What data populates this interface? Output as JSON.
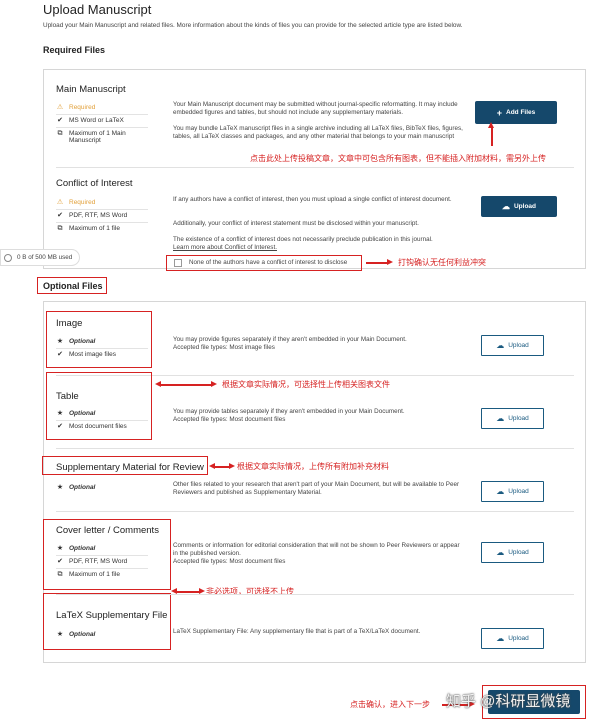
{
  "header": {
    "title": "Upload Manuscript",
    "description": "Upload your Main Manuscript and related files. More information about the kinds of files you can provide for the selected article type are listed below.",
    "required_title": "Required Files",
    "optional_title": "Optional Files"
  },
  "storage": {
    "label": "0 B of 500 MB used"
  },
  "main_manuscript": {
    "title": "Main Manuscript",
    "meta": [
      "Required",
      "MS Word or LaTeX",
      "Maximum of 1 Main Manuscript"
    ],
    "desc1": "Your Main Manuscript document may be submitted without journal-specific reformatting. It may include embedded figures and tables, but should not include any supplementary materials.",
    "desc2": "You may bundle LaTeX manuscript files in a single archive including all LaTeX files, BibTeX files, figures, tables, all LaTeX classes and packages, and any other material that belongs to your main manuscript",
    "button": "Add Files"
  },
  "conflict": {
    "title": "Conflict of Interest",
    "meta": [
      "Required",
      "PDF, RTF, MS Word",
      "Maximum of 1 file"
    ],
    "desc1": "If any authors have a conflict of interest, then you must upload a single conflict of interest document.",
    "desc2": "Additionally, your conflict of interest statement must be disclosed within your manuscript.",
    "desc3": "The existence of a conflict of interest does not necessarily preclude publication in this journal.",
    "link": "Learn more about Conflict of Interest.",
    "checkbox": "None of the authors have a conflict of interest to disclose",
    "button": "Upload"
  },
  "optional": [
    {
      "title": "Image",
      "meta": [
        "Optional",
        "Most image files"
      ],
      "desc": [
        "You may provide figures separately if they aren't embedded in your Main Document.",
        "Accepted file types: Most image files"
      ],
      "button": "Upload"
    },
    {
      "title": "Table",
      "meta": [
        "Optional",
        "Most document files"
      ],
      "desc": [
        "You may provide tables separately if they aren't embedded in your Main Document.",
        "Accepted file types: Most document files"
      ],
      "button": "Upload"
    },
    {
      "title": "Supplementary Material for Review",
      "meta": [
        "Optional"
      ],
      "desc": [
        "Other files related to your research that aren't part of your Main Document, but will be available to Peer Reviewers and published as Supplementary Material."
      ],
      "button": "Upload"
    },
    {
      "title": "Cover letter / Comments",
      "meta": [
        "Optional",
        "PDF, RTF, MS Word",
        "Maximum of 1 file"
      ],
      "desc": [
        "Comments or information for editorial consideration that will not be shown to Peer Reviewers or appear in the published version.",
        "Accepted file types: Most document files"
      ],
      "button": "Upload"
    },
    {
      "title": "LaTeX Supplementary File",
      "meta": [
        "Optional"
      ],
      "desc": [
        "LaTeX Supplementary File: Any supplementary file that is part of a TeX/LaTeX document."
      ],
      "button": "Upload"
    }
  ],
  "annotations": {
    "a1": "点击此处上传投稿文章，文章中可包含所有图表，但不能插入附加材料，需另外上传",
    "a2": "打钩确认无任何利益冲突",
    "a3": "根据文章实际情况，可选择性上传相关图表文件",
    "a4": "根据文章实际情况，上传所有附加补充材料",
    "a5": "非必选项，可选择不上传",
    "a6": "点击确认，进入下一步"
  },
  "watermark": "知乎 @科研显微镜"
}
